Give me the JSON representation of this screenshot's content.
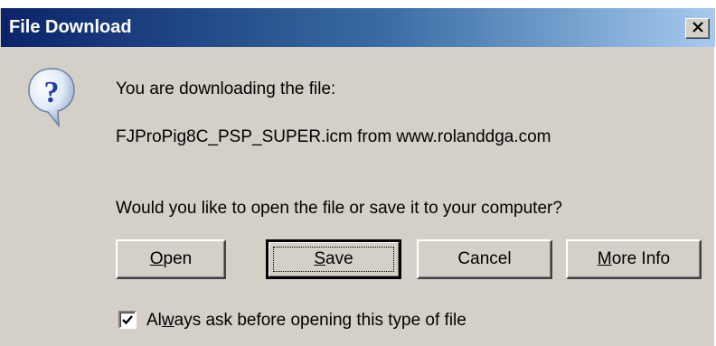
{
  "window": {
    "title": "File Download",
    "close_label": "×"
  },
  "message": {
    "line1": "You are downloading the file:",
    "filename_line": "FJProPig8C_PSP_SUPER.icm from www.rolanddga.com",
    "question": "Would you like to open the file or save it to your computer?"
  },
  "buttons": {
    "open": {
      "pre": "",
      "mnemonic": "O",
      "post": "pen"
    },
    "save": {
      "pre": "",
      "mnemonic": "S",
      "post": "ave"
    },
    "cancel": {
      "label": "Cancel"
    },
    "more_info": {
      "pre": "",
      "mnemonic": "M",
      "post": "ore Info"
    }
  },
  "checkbox": {
    "checked": true,
    "label_pre": "Al",
    "label_mnemonic": "w",
    "label_post": "ays ask before opening this type of file"
  },
  "icons": {
    "question": "question-icon",
    "close": "close-icon",
    "check": "check-icon"
  },
  "colors": {
    "title_start": "#0a246a",
    "title_end": "#a6caf0",
    "face": "#d4d0c8"
  }
}
